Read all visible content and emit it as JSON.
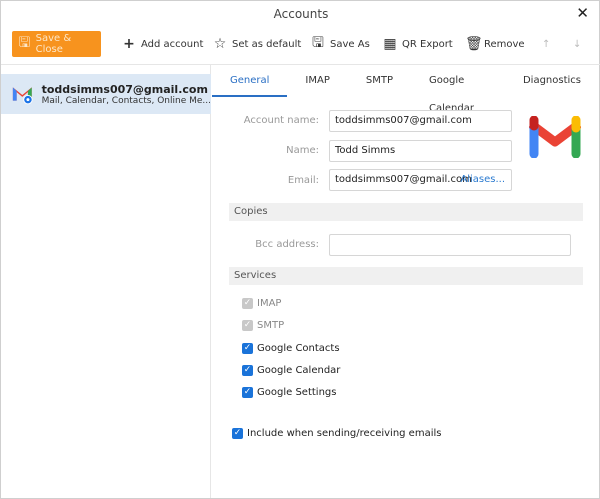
{
  "window": {
    "title": "Accounts"
  },
  "toolbar": {
    "save_close": "Save & Close",
    "add_account": "Add account",
    "set_default": "Set as default",
    "save_as": "Save As",
    "qr_export": "QR Export",
    "remove": "Remove"
  },
  "sidebar": {
    "accounts": [
      {
        "email": "toddsimms007@gmail.com",
        "services": "Mail, Calendar, Contacts, Online Me..."
      }
    ]
  },
  "tabs": [
    {
      "label": "General"
    },
    {
      "label": "IMAP"
    },
    {
      "label": "SMTP"
    },
    {
      "label": "Google Calendar"
    },
    {
      "label": "Diagnostics"
    }
  ],
  "general": {
    "account_name_label": "Account name:",
    "account_name": "toddsimms007@gmail.com",
    "name_label": "Name:",
    "name": "Todd Simms",
    "email_label": "Email:",
    "email": "toddsimms007@gmail.com",
    "aliases": "Aliases...",
    "copies_header": "Copies",
    "bcc_label": "Bcc address:",
    "bcc": "",
    "services_header": "Services",
    "services": [
      {
        "label": "IMAP",
        "checked": true,
        "disabled": true
      },
      {
        "label": "SMTP",
        "checked": true,
        "disabled": true
      },
      {
        "label": "Google Contacts",
        "checked": true
      },
      {
        "label": "Google Calendar",
        "checked": true
      },
      {
        "label": "Google Settings",
        "checked": true
      }
    ],
    "include_label": "Include when sending/receiving emails"
  },
  "colors": {
    "accent": "#2a6fc4",
    "save_button": "#f7931e",
    "selected_row": "#dce8f5"
  }
}
